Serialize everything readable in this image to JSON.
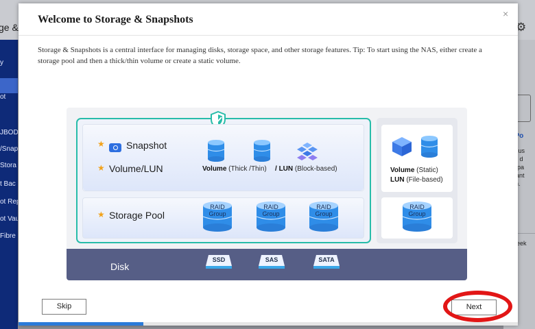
{
  "background": {
    "title_fragment": "ge &",
    "sidebar_items": [
      "y",
      "ot",
      "JBOD",
      "/Snap",
      "Stora",
      "t Bac",
      "ot Rep",
      "ot Vau",
      "Fibre"
    ],
    "right_title": "ge Po",
    "right_lines": [
      "ol is us",
      "sical d",
      "ge spa",
      "undant",
      "ction."
    ],
    "right_bottom": "st week"
  },
  "dialog": {
    "title": "Welcome to Storage & Snapshots",
    "close_icon": "×",
    "description": "Storage & Snapshots is a central interface for managing disks, storage space, and other storage features. Tip: To start using the NAS, either create a storage pool and then a thick/thin volume or create a static volume."
  },
  "illustration": {
    "snapshot_label": "Snapshot",
    "volume_lun_label": "Volume/LUN",
    "storage_pool_label": "Storage Pool",
    "star": "★",
    "volume_caption_bold": "Volume",
    "volume_caption_rest": " (Thick /Thin)",
    "slash": "/",
    "lun_caption_bold": "LUN",
    "lun_caption_rest": " (Block-based)",
    "static_volume_bold": "Volume",
    "static_volume_rest": " (Static)",
    "lun_file_bold": "LUN",
    "lun_file_rest": " (File-based)",
    "raid_line1": "RAID",
    "raid_line2": "Group",
    "disk_label": "Disk",
    "drives": [
      "SSD",
      "SAS",
      "SATA"
    ]
  },
  "footer": {
    "skip_label": "Skip",
    "next_label": "Next",
    "progress_fraction": 0.25
  },
  "colors": {
    "accent_teal": "#27bca9",
    "primary_blue": "#2e6fe0",
    "highlight_red": "#e21616",
    "disk_bar": "#565e86",
    "star": "#f2a21a"
  }
}
